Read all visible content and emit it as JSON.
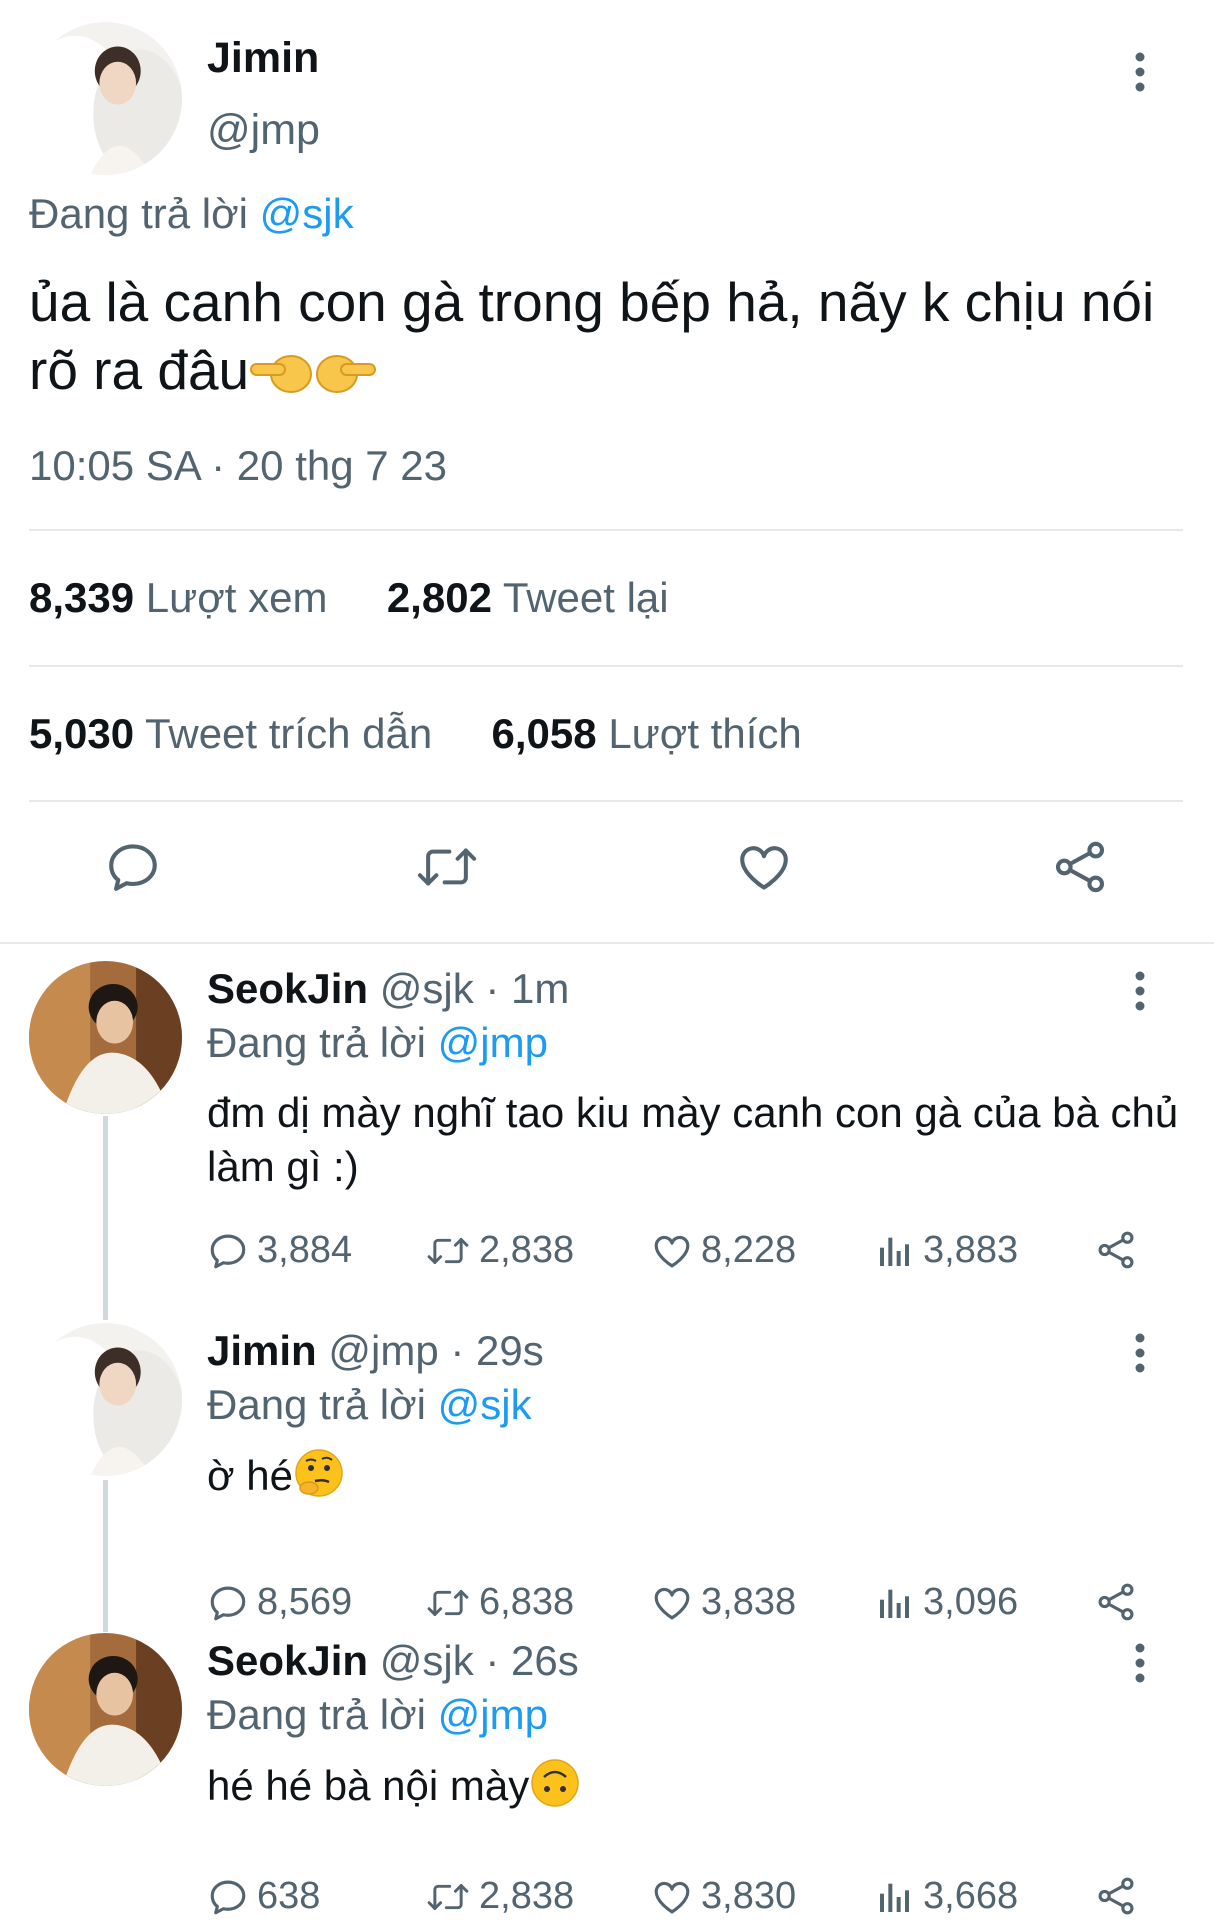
{
  "main_tweet": {
    "author_name": "Jimin",
    "author_handle": "@jmp",
    "replying_prefix": "Đang trả lời",
    "replying_to": "@sjk",
    "text": "ủa là canh con gà trong bếp hả, nãy k chịu nói rõ ra đâu",
    "text_emoji": [
      "backhand-index-pointing-left",
      "backhand-index-pointing-right"
    ],
    "timestamp": "10:05 SA · 20 thg 7 23",
    "stats": {
      "views_count": "8,339",
      "views_label": "Lượt xem",
      "retweets_count": "2,802",
      "retweets_label": "Tweet lại",
      "quotes_count": "5,030",
      "quotes_label": "Tweet trích dẫn",
      "likes_count": "6,058",
      "likes_label": "Lượt thích"
    },
    "actions": [
      "reply-icon",
      "retweet-icon",
      "like-icon",
      "share-icon"
    ]
  },
  "replies": [
    {
      "author_name": "SeokJin",
      "author_handle": "@sjk",
      "time": "· 1m",
      "replying_prefix": "Đang trả lời",
      "replying_to": "@jmp",
      "text": "đm dị mày nghĩ tao kiu mày canh con gà của bà chủ làm gì :)",
      "text_emoji": "",
      "metrics": {
        "replies": "3,884",
        "retweets": "2,838",
        "likes": "8,228",
        "views": "3,883"
      }
    },
    {
      "author_name": "Jimin",
      "author_handle": "@jmp",
      "time": "· 29s",
      "replying_prefix": "Đang trả lời",
      "replying_to": "@sjk",
      "text": "ờ hé",
      "text_emoji": "thinking-face",
      "metrics": {
        "replies": "8,569",
        "retweets": "6,838",
        "likes": "3,838",
        "views": "3,096"
      }
    },
    {
      "author_name": "SeokJin",
      "author_handle": "@sjk",
      "time": "· 26s",
      "replying_prefix": "Đang trả lời",
      "replying_to": "@jmp",
      "text": "hé hé bà nội mày",
      "text_emoji": "upside-down-face",
      "metrics": {
        "replies": "638",
        "retweets": "2,838",
        "likes": "3,830",
        "views": "3,668"
      }
    }
  ],
  "colors": {
    "text": "#0f1419",
    "muted": "#536471",
    "link": "#1d9bf0",
    "divider": "#e6e9eb",
    "thread_line": "#cfd9de"
  }
}
